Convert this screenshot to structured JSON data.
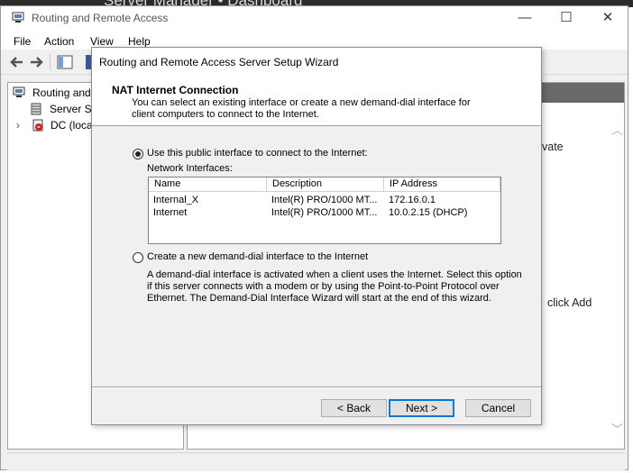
{
  "background_window": {
    "title": "Server Manager • Dashboard"
  },
  "window": {
    "title": "Routing and Remote Access",
    "controls": {
      "minimize": "—",
      "maximize": "☐",
      "close": "✕"
    }
  },
  "menu": [
    "File",
    "Action",
    "View",
    "Help"
  ],
  "tree": {
    "root": "Routing and",
    "server_status": "Server Sta",
    "dc": "DC (local"
  },
  "right_pane": {
    "frag1": "vate",
    "frag2": "click Add"
  },
  "wizard": {
    "title": "Routing and Remote Access Server Setup Wizard",
    "page_title": "NAT Internet Connection",
    "page_subtitle": "You can select an existing interface or create a new demand-dial interface for client computers to connect to the Internet.",
    "option_public": "Use this public interface to connect to the Internet:",
    "network_interfaces_label": "Network Interfaces:",
    "table": {
      "columns": [
        "Name",
        "Description",
        "IP Address"
      ],
      "rows": [
        [
          "Internal_X",
          "Intel(R) PRO/1000 MT...",
          "172.16.0.1"
        ],
        [
          "Internet",
          "Intel(R) PRO/1000 MT...",
          "10.0.2.15 (DHCP)"
        ]
      ]
    },
    "option_demand": "Create a new demand-dial interface to the Internet",
    "demand_description": "A demand-dial interface is activated when a client uses the Internet. Select this option if this server connects with a modem or by using the Point-to-Point Protocol over Ethernet. The Demand-Dial Interface Wizard will start at the end of this wizard.",
    "buttons": {
      "back": "< Back",
      "next": "Next >",
      "cancel": "Cancel"
    },
    "selected_option": "public"
  },
  "colors": {
    "accent": "#0078d7",
    "header_gray": "#696969"
  }
}
